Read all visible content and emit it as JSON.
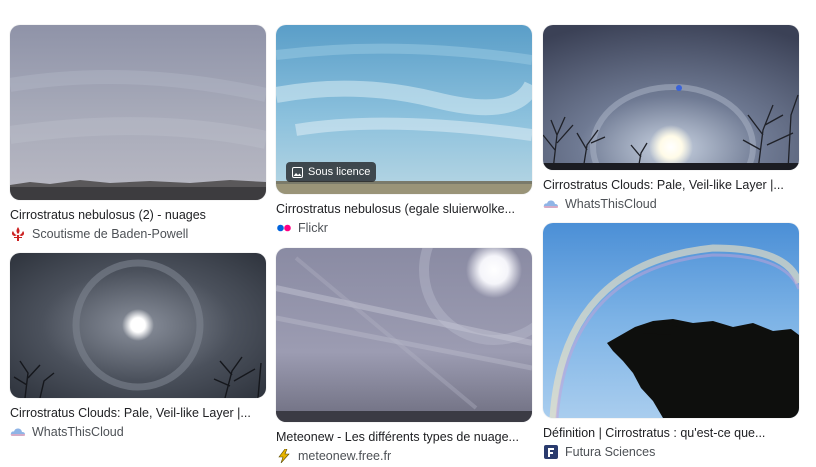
{
  "results": [
    {
      "title": "Cirrostratus nebulosus (2) - nuages",
      "source": "Scoutisme de Baden-Powell",
      "favicon": "fleur-de-lis-icon",
      "favicon_color": "#cc2222"
    },
    {
      "title": "Cirrostratus nebulosus (egale sluierwolke...",
      "source": "Flickr",
      "favicon": "flickr-icon",
      "badge": "Sous licence"
    },
    {
      "title": "Cirrostratus Clouds: Pale, Veil-like Layer |...",
      "source": "WhatsThisCloud",
      "favicon": "cloud-icon"
    },
    {
      "title": "Cirrostratus Clouds: Pale, Veil-like Layer |...",
      "source": "WhatsThisCloud",
      "favicon": "cloud-icon"
    },
    {
      "title": "Meteonew - Les différents types de nuage...",
      "source": "meteonew.free.fr",
      "favicon": "lightning-icon",
      "favicon_color": "#e8b400"
    },
    {
      "title": "Définition | Cirrostratus : qu'est-ce que...",
      "source": "Futura Sciences",
      "favicon": "futura-f-icon",
      "favicon_color": "#2a3b6e"
    }
  ]
}
